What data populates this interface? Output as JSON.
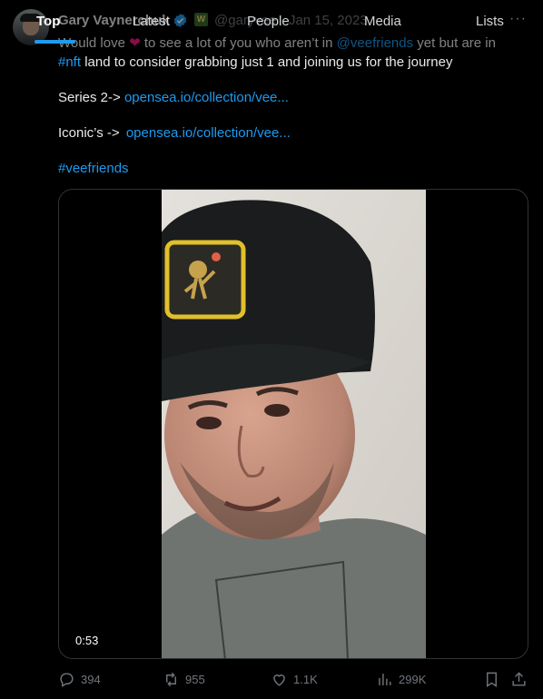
{
  "tabs": [
    {
      "label": "Top",
      "active": true
    },
    {
      "label": "Latest",
      "active": false
    },
    {
      "label": "People",
      "active": false
    },
    {
      "label": "Media",
      "active": false
    },
    {
      "label": "Lists",
      "active": false
    }
  ],
  "tweet": {
    "author_name": "Gary Vaynerchuk",
    "affiliate_badge": "W",
    "handle": "@garyvee",
    "date": "Jan 15, 2023",
    "more_icon": "more-horizontal-icon",
    "text": {
      "line1_pre": "Would love ",
      "heart": "❤",
      "line1_mid": " to see a lot of you who aren’t in ",
      "mention": "@veefriends",
      "line1_post": " yet but are in",
      "hashtag_nft": "#nft",
      "line2_post": " land to consider grabbing just 1 and joining us for the journey",
      "series_label": "Series 2-> ",
      "series_link": "opensea.io/collection/vee...",
      "iconic_label": "Iconic’s -> ",
      "iconic_link": "opensea.io/collection/vee...",
      "hashtag_vf": "#veefriends"
    },
    "video": {
      "duration": "0:53"
    },
    "actions": {
      "replies": "394",
      "reposts": "955",
      "likes": "1.1K",
      "views": "299K"
    }
  },
  "colors": {
    "background": "#000000",
    "text": "#e7e9ea",
    "muted": "#71767b",
    "accent": "#1d9bf0",
    "heart": "#f91880"
  }
}
